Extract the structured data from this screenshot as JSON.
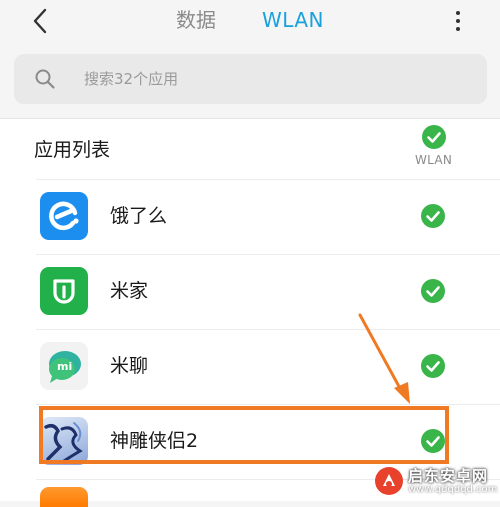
{
  "header": {
    "tabs": [
      {
        "label": "数据",
        "active": false
      },
      {
        "label": "WLAN",
        "active": true
      }
    ]
  },
  "search": {
    "placeholder": "搜索32个应用"
  },
  "list": {
    "title": "应用列表",
    "column_label": "WLAN",
    "column_all_checked": true,
    "apps": [
      {
        "name": "饿了么",
        "icon": "eleme-app-icon",
        "wlan_enabled": true
      },
      {
        "name": "米家",
        "icon": "mijia-app-icon",
        "wlan_enabled": true
      },
      {
        "name": "米聊",
        "icon": "miliao-app-icon",
        "wlan_enabled": true
      },
      {
        "name": "神雕侠侣2",
        "icon": "shendiao-app-icon",
        "wlan_enabled": true
      }
    ]
  },
  "watermark": {
    "text": "启东安卓网",
    "url": "www.qdqdqd.com"
  },
  "colors": {
    "accent": "#1aa1dc",
    "check_green": "#39b54a",
    "highlight_orange": "#f07a24"
  }
}
